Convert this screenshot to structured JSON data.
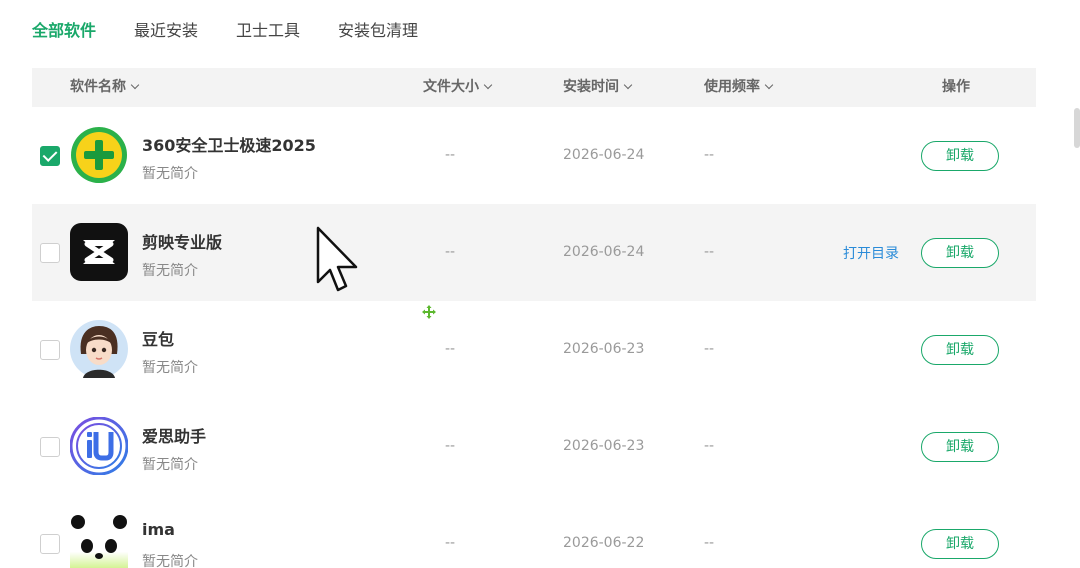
{
  "tabs": [
    {
      "label": "全部软件",
      "active": true
    },
    {
      "label": "最近安装",
      "active": false
    },
    {
      "label": "卫士工具",
      "active": false
    },
    {
      "label": "安装包清理",
      "active": false
    }
  ],
  "columns": {
    "name": "软件名称",
    "size": "文件大小",
    "time": "安装时间",
    "freq": "使用频率",
    "op": "操作"
  },
  "apps": [
    {
      "name": "360安全卫士极速2025",
      "desc": "暂无简介",
      "size": "--",
      "install_date": "2026-06-24",
      "frequency": "--",
      "checked": true,
      "icon": "360-security-icon",
      "uninstall": "卸载"
    },
    {
      "name": "剪映专业版",
      "desc": "暂无简介",
      "size": "--",
      "install_date": "2026-06-24",
      "frequency": "--",
      "checked": false,
      "icon": "capcut-icon",
      "open_dir": "打开目录",
      "uninstall": "卸载"
    },
    {
      "name": "豆包",
      "desc": "暂无简介",
      "size": "--",
      "install_date": "2026-06-23",
      "frequency": "--",
      "checked": false,
      "icon": "doubao-icon",
      "uninstall": "卸载"
    },
    {
      "name": "爱思助手",
      "desc": "暂无简介",
      "size": "--",
      "install_date": "2026-06-23",
      "frequency": "--",
      "checked": false,
      "icon": "i4-assistant-icon",
      "uninstall": "卸载"
    },
    {
      "name": "ima",
      "desc": "暂无简介",
      "size": "--",
      "install_date": "2026-06-22",
      "frequency": "--",
      "checked": false,
      "icon": "ima-panda-icon",
      "uninstall": "卸载"
    }
  ],
  "colors": {
    "accent": "#1aa86a",
    "link": "#2a8bd8",
    "header_bg": "#f3f3f3",
    "row_hover_bg": "#f4f4f4"
  }
}
